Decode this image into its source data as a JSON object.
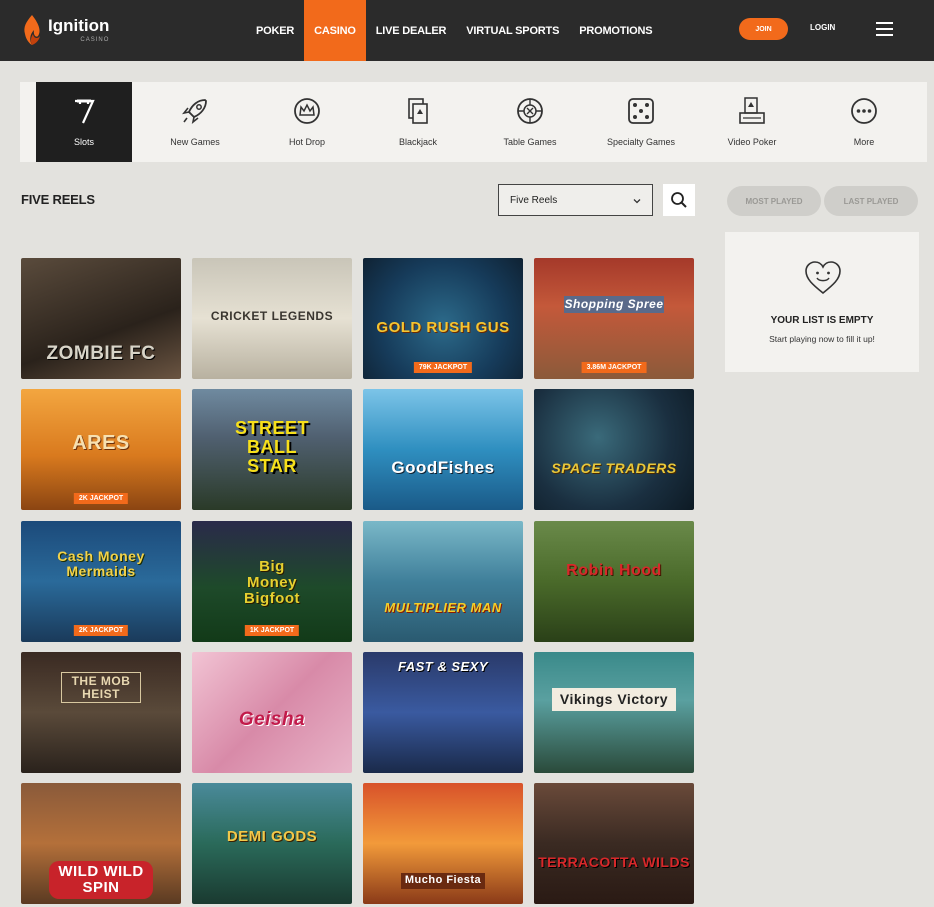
{
  "brand": {
    "name": "Ignition",
    "sub": "CASINO"
  },
  "nav": [
    "POKER",
    "CASINO",
    "LIVE DEALER",
    "VIRTUAL SPORTS",
    "PROMOTIONS"
  ],
  "header": {
    "join": "JOIN",
    "login": "LOGIN"
  },
  "categories": [
    "Slots",
    "New Games",
    "Hot Drop",
    "Blackjack",
    "Table Games",
    "Specialty Games",
    "Video Poker",
    "More"
  ],
  "section": {
    "title": "FIVE REELS",
    "filter_value": "Five Reels"
  },
  "sidebar": {
    "tabs": [
      "MOST PLAYED",
      "LAST PLAYED"
    ],
    "empty_title": "YOUR LIST IS EMPTY",
    "empty_sub": "Start playing now to fill it up!"
  },
  "games": [
    {
      "title": "ZOMBIE FC",
      "jackpot": ""
    },
    {
      "title": "CRICKET LEGENDS",
      "jackpot": ""
    },
    {
      "title": "GOLD RUSH GUS",
      "jackpot": "79K JACKPOT"
    },
    {
      "title": "Shopping Spree",
      "jackpot": "3.86M JACKPOT"
    },
    {
      "title": "ARES",
      "jackpot": "2K JACKPOT"
    },
    {
      "title": "STREET BALL STAR",
      "jackpot": ""
    },
    {
      "title": "GoodFishes",
      "jackpot": ""
    },
    {
      "title": "SPACE TRADERS",
      "jackpot": ""
    },
    {
      "title": "Cash Money Mermaids",
      "jackpot": "2K JACKPOT"
    },
    {
      "title": "Big Money Bigfoot",
      "jackpot": "1K JACKPOT"
    },
    {
      "title": "MULTIPLIER MAN",
      "jackpot": ""
    },
    {
      "title": "Robin Hood",
      "jackpot": ""
    },
    {
      "title": "THE MOB HEIST",
      "jackpot": ""
    },
    {
      "title": "Geisha",
      "jackpot": ""
    },
    {
      "title": "FAST & SEXY",
      "jackpot": ""
    },
    {
      "title": "Vikings Victory",
      "jackpot": ""
    },
    {
      "title": "WILD WILD SPIN",
      "jackpot": ""
    },
    {
      "title": "DEMI GODS",
      "jackpot": ""
    },
    {
      "title": "Mucho Fiesta",
      "jackpot": ""
    },
    {
      "title": "TERRACOTTA WILDS",
      "jackpot": ""
    }
  ]
}
